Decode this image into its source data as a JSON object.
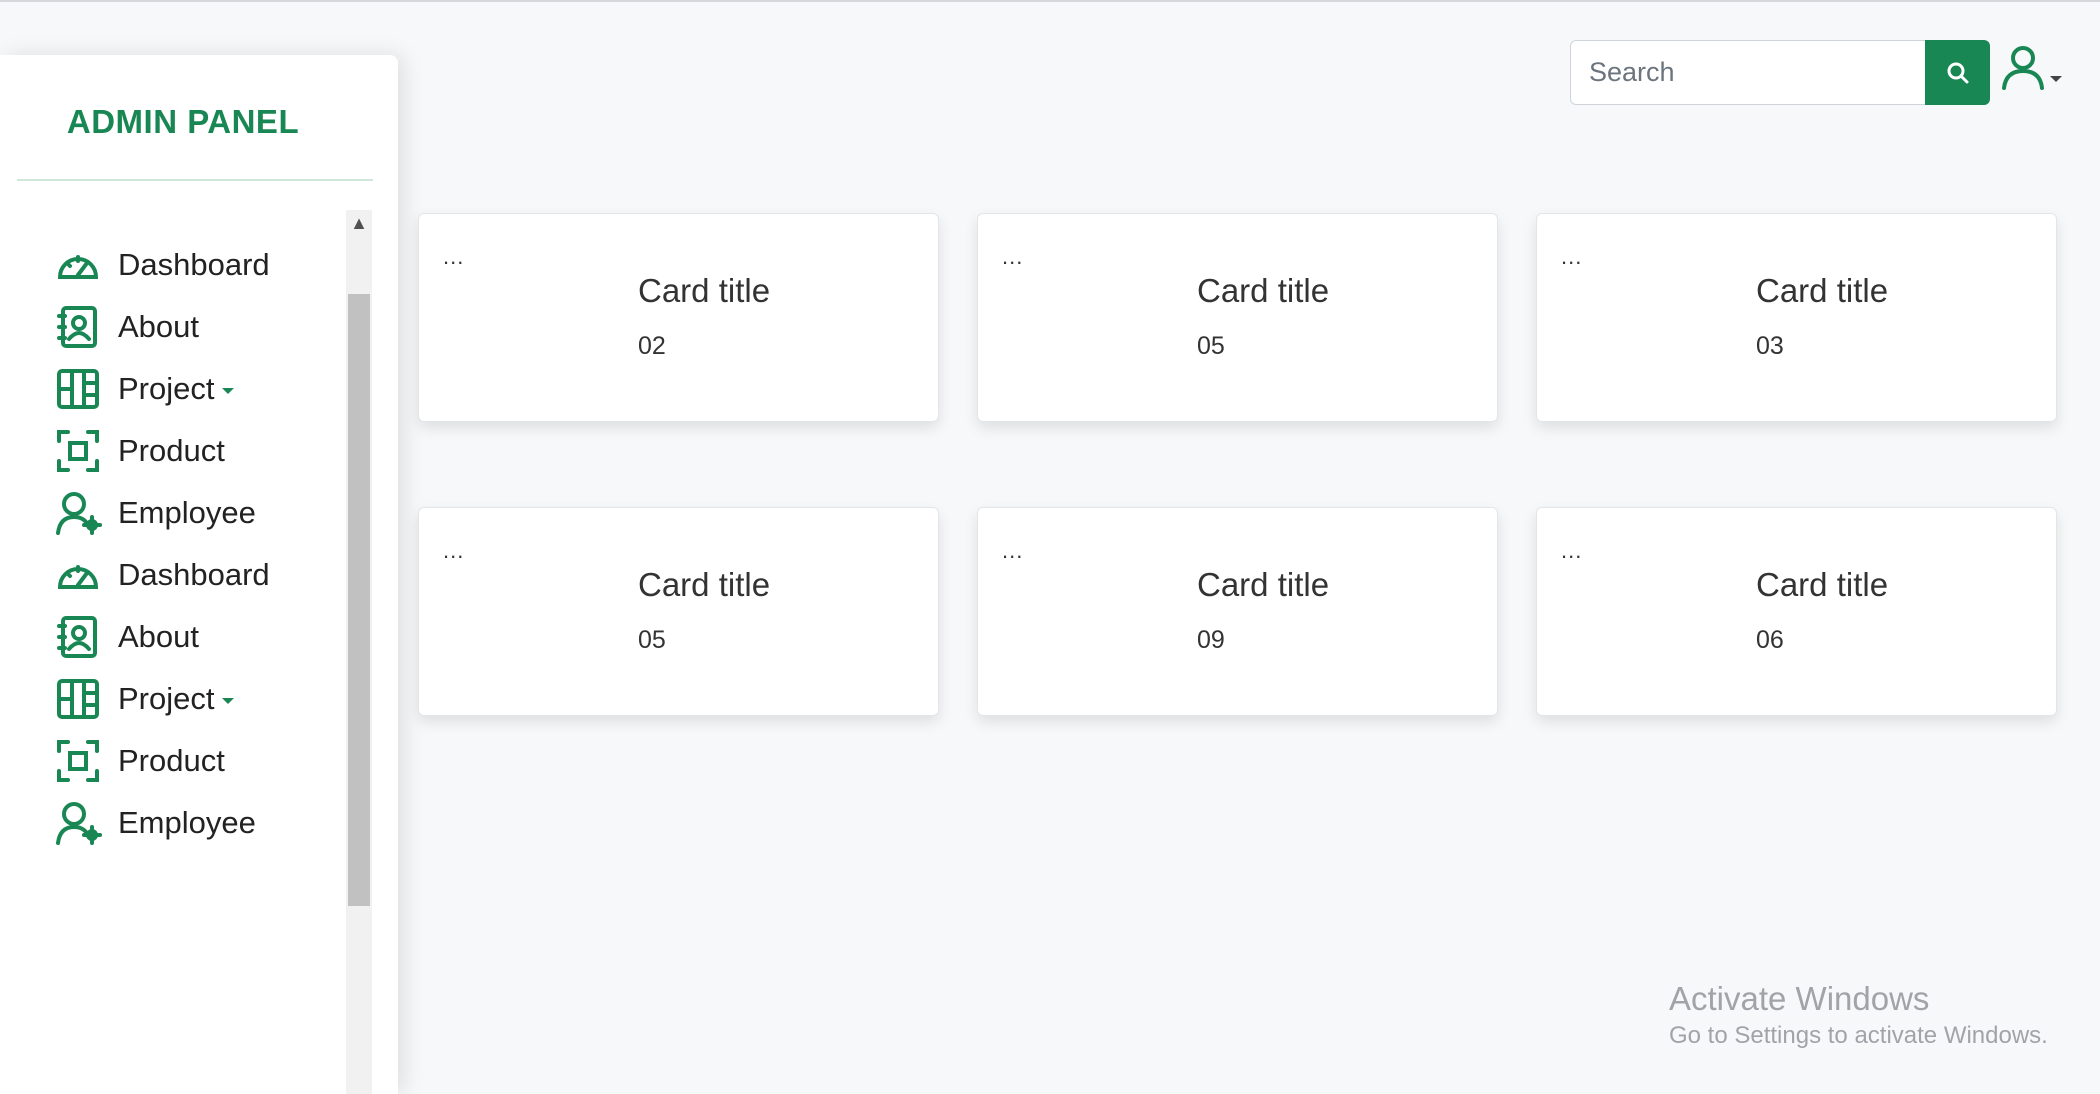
{
  "sidebar": {
    "brand": "ADMIN PANEL",
    "items": [
      {
        "label": "Dashboard",
        "icon": "dashboard-gauge-icon",
        "has_dropdown": false
      },
      {
        "label": "About",
        "icon": "contact-book-icon",
        "has_dropdown": false
      },
      {
        "label": "Project",
        "icon": "kanban-icon",
        "has_dropdown": true
      },
      {
        "label": "Product",
        "icon": "product-frame-icon",
        "has_dropdown": false
      },
      {
        "label": "Employee",
        "icon": "user-gear-icon",
        "has_dropdown": false
      },
      {
        "label": "Dashboard",
        "icon": "dashboard-gauge-icon",
        "has_dropdown": false
      },
      {
        "label": "About",
        "icon": "contact-book-icon",
        "has_dropdown": false
      },
      {
        "label": "Project",
        "icon": "kanban-icon",
        "has_dropdown": true
      },
      {
        "label": "Product",
        "icon": "product-frame-icon",
        "has_dropdown": false
      },
      {
        "label": "Employee",
        "icon": "user-gear-icon",
        "has_dropdown": false
      }
    ]
  },
  "header": {
    "search": {
      "placeholder": "Search",
      "value": "",
      "button_icon": "search-icon"
    },
    "user_menu": {
      "icon": "user-icon"
    }
  },
  "cards": [
    {
      "menu": "...",
      "title": "Card title",
      "value": "02"
    },
    {
      "menu": "...",
      "title": "Card title",
      "value": "05"
    },
    {
      "menu": "...",
      "title": "Card title",
      "value": "03"
    },
    {
      "menu": "...",
      "title": "Card title",
      "value": "05"
    },
    {
      "menu": "...",
      "title": "Card title",
      "value": "09"
    },
    {
      "menu": "...",
      "title": "Card title",
      "value": "06"
    }
  ],
  "watermark": {
    "title": "Activate Windows",
    "subtitle": "Go to Settings to activate Windows."
  },
  "colors": {
    "accent": "#198754",
    "background": "#f7f8f9",
    "card": "#ffffff"
  }
}
